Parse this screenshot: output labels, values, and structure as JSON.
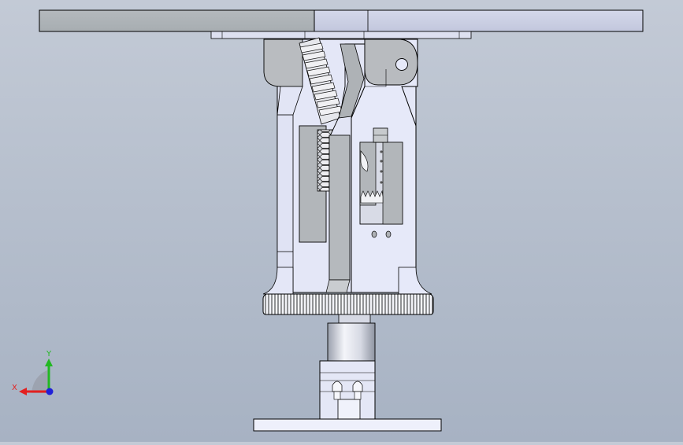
{
  "viewport": {
    "background_top": "#c3cad6",
    "background_bottom": "#a7b2c3"
  },
  "model": {
    "part_fill_light": "#e8ebf8",
    "part_fill_mid": "#cfd4ea",
    "part_fill_gray": "#aeb3b7",
    "edge_color": "#000000"
  },
  "triad": {
    "x_label": "X",
    "y_label": "Y",
    "x_color": "#e32020",
    "y_color": "#22b822",
    "z_color": "#2020d8",
    "icons": [
      "axis-triad-icon"
    ]
  }
}
